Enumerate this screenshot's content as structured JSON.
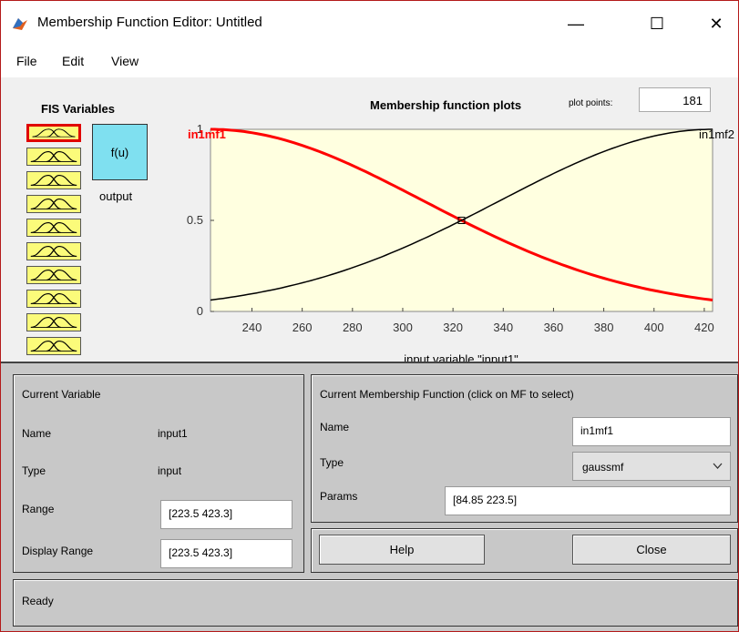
{
  "window": {
    "title": "Membership Function Editor: Untitled",
    "minimize": "—",
    "maximize": "☐",
    "close": "✕"
  },
  "menu": [
    "File",
    "Edit",
    "View"
  ],
  "fis": {
    "title": "FIS Variables",
    "input_count": 10,
    "output_func": "f(u)",
    "output_label": "output"
  },
  "plot": {
    "title": "Membership function plots",
    "plot_points_label": "plot points:",
    "plot_points": "181",
    "mf1_label": "in1mf1",
    "mf2_label": "in1mf2",
    "xlabel": "input variable \"input1\""
  },
  "chart_data": {
    "type": "line",
    "xlim": [
      223.5,
      423.3
    ],
    "ylim": [
      0,
      1
    ],
    "x_ticks": [
      "240",
      "260",
      "280",
      "300",
      "320",
      "340",
      "360",
      "380",
      "400",
      "420"
    ],
    "y_ticks": [
      "0",
      "0.5",
      "1"
    ],
    "series": [
      {
        "name": "in1mf1",
        "mf": "gaussmf",
        "sigma": 84.85,
        "center": 223.5,
        "color": "#ff0000",
        "selected": true
      },
      {
        "name": "in1mf2",
        "mf": "gaussmf",
        "sigma": 84.85,
        "center": 423.3,
        "color": "#000000",
        "selected": false
      }
    ]
  },
  "current_variable": {
    "title": "Current Variable",
    "name_label": "Name",
    "name": "input1",
    "type_label": "Type",
    "type": "input",
    "range_label": "Range",
    "range": "[223.5 423.3]",
    "display_range_label": "Display Range",
    "display_range": "[223.5 423.3]"
  },
  "current_mf": {
    "title": "Current Membership Function (click on MF to select)",
    "name_label": "Name",
    "name": "in1mf1",
    "type_label": "Type",
    "type": "gaussmf",
    "params_label": "Params",
    "params": "[84.85 223.5]"
  },
  "buttons": {
    "help": "Help",
    "close": "Close"
  },
  "status": "Ready"
}
